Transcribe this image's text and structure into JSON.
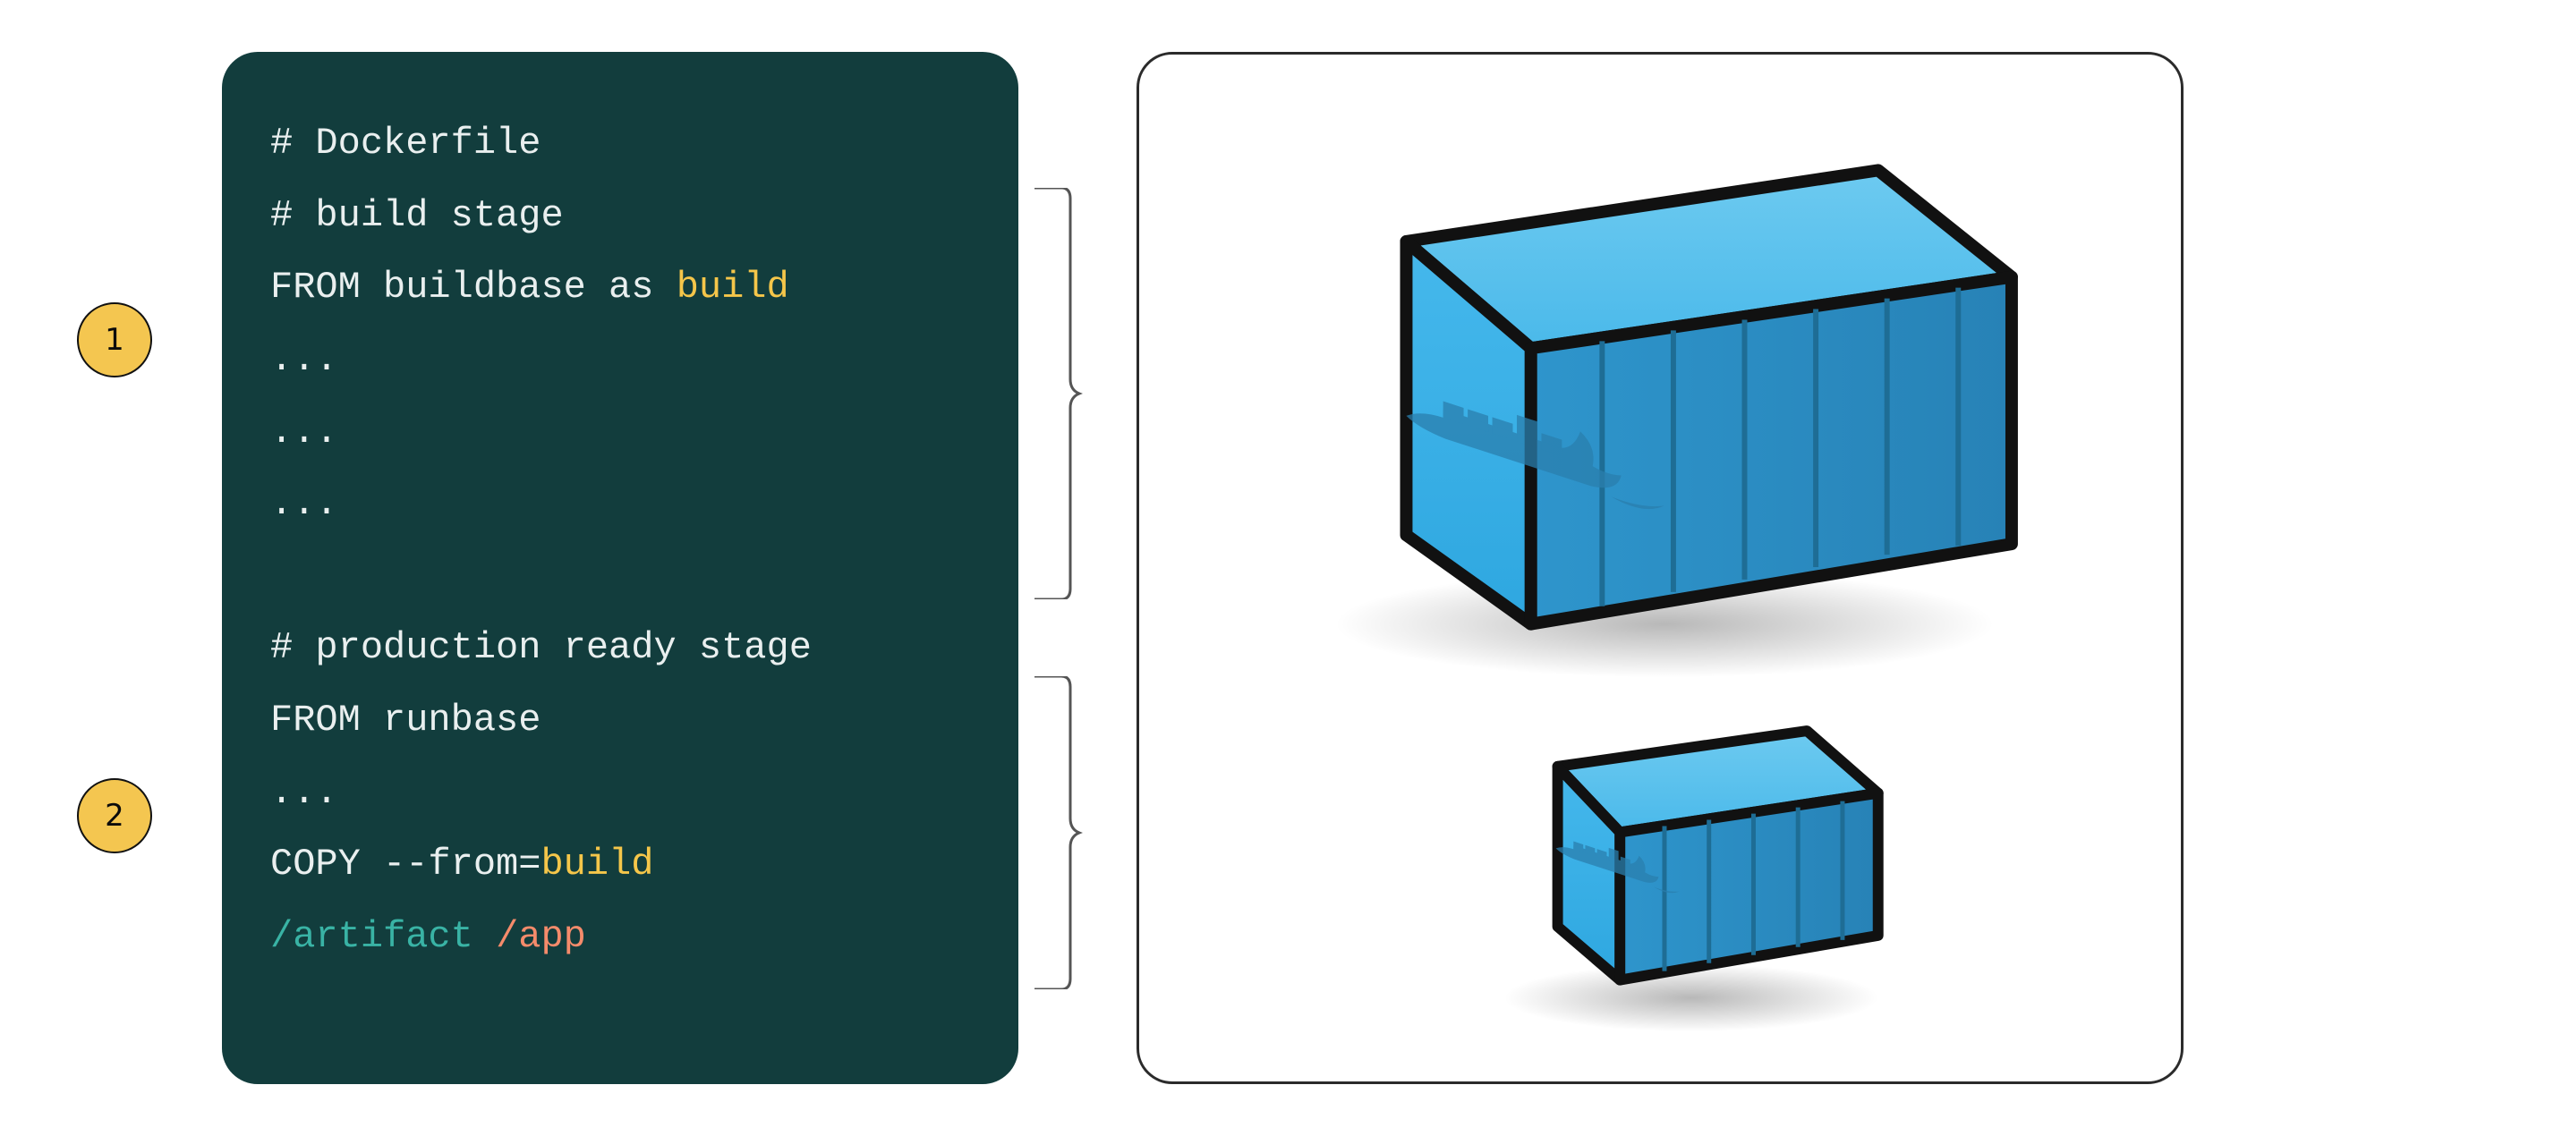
{
  "badges": {
    "one": "1",
    "two": "2"
  },
  "code": {
    "l1": "# Dockerfile",
    "l2": "# build stage",
    "l3a": "FROM buildbase as ",
    "l3b": "build",
    "l4": "...",
    "l5": "...",
    "l6": "...",
    "l7": "",
    "l8": "# production ready stage",
    "l9": "FROM runbase",
    "l10": "...",
    "l11a": "COPY --from=",
    "l11b": "build",
    "l12a": "/artifact",
    "l12b": " ",
    "l12c": "/app"
  },
  "colors": {
    "codeBg": "#123d3d",
    "codeText": "#e9efef",
    "yellow": "#f5c64a",
    "teal": "#39b3a5",
    "coral": "#f58b6b",
    "badgeBg": "#f4c650",
    "containerBlue": "#3fb5ee",
    "containerBlueDark": "#2c8ec9"
  },
  "illustration": {
    "description": "Two Docker-style shipping containers: a large one on top, a smaller one below, each with the Docker whale silhouette on the side."
  }
}
